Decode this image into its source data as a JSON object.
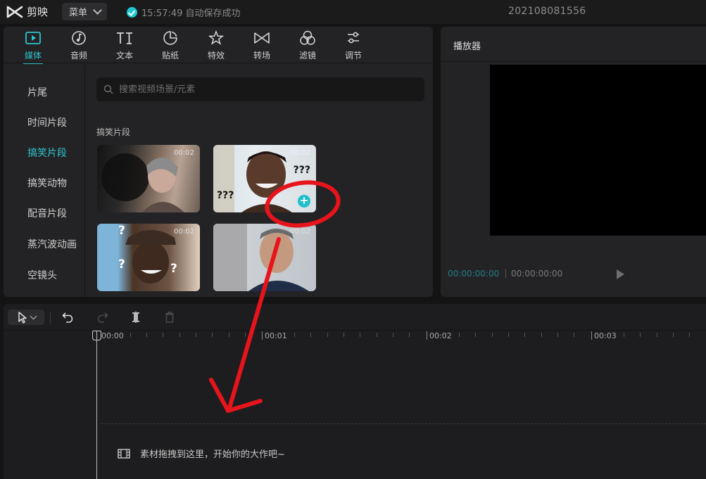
{
  "app": {
    "name": "剪映",
    "menu_label": "菜单",
    "save_status": "15:57:49 自动保存成功",
    "project_name": "202108081556"
  },
  "toolbar": {
    "tabs": [
      {
        "label": "媒体",
        "icon": "media-icon",
        "active": true
      },
      {
        "label": "音频",
        "icon": "audio-icon"
      },
      {
        "label": "文本",
        "icon": "text-icon"
      },
      {
        "label": "贴纸",
        "icon": "sticker-icon"
      },
      {
        "label": "特效",
        "icon": "effects-icon"
      },
      {
        "label": "转场",
        "icon": "transition-icon"
      },
      {
        "label": "滤镜",
        "icon": "filter-icon"
      },
      {
        "label": "调节",
        "icon": "adjust-icon"
      }
    ]
  },
  "categories": {
    "items": [
      "片尾",
      "时间片段",
      "搞笑片段",
      "搞笑动物",
      "配音片段",
      "蒸汽波动画",
      "空镜头"
    ],
    "active_index": 2
  },
  "content": {
    "search_placeholder": "搜索视频场景/元素",
    "section_title": "搞笑片段",
    "clips": [
      {
        "duration": "00:02"
      },
      {
        "duration": "00:02",
        "caption_left": "???",
        "caption_right": "???",
        "has_add_button": true
      },
      {
        "duration": "00:02",
        "caption": "?"
      },
      {
        "duration": "00:02"
      }
    ]
  },
  "player": {
    "title": "播放器",
    "current_time": "00:00:00:00",
    "total_time": "00:00:00:00"
  },
  "timeline": {
    "ruler_labels": [
      "00:00",
      "00:01",
      "00:02",
      "00:03"
    ],
    "drop_hint": "素材拖拽到这里，开始你的大作吧~"
  },
  "colors": {
    "accent": "#2ec4cf",
    "annotation": "#e8141b",
    "background": "#141414",
    "panel": "#232325"
  }
}
